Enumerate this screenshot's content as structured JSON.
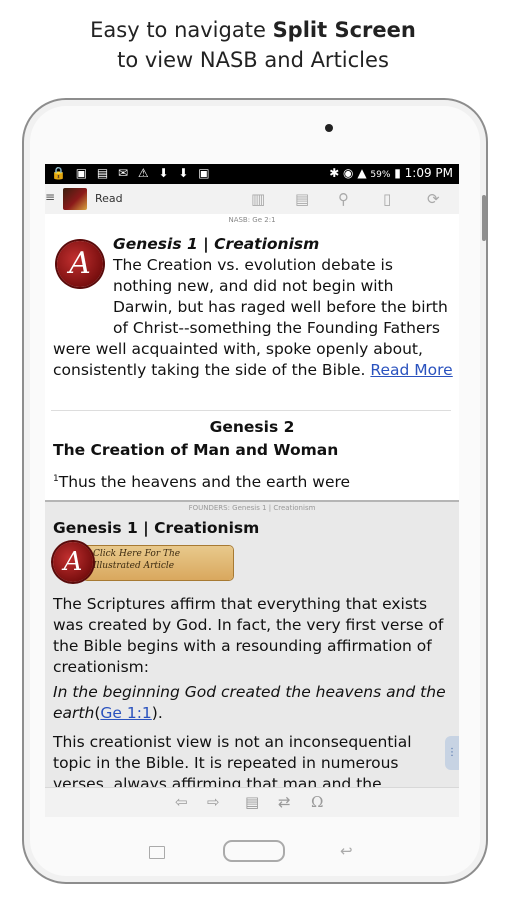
{
  "caption": {
    "line1_prefix": "Easy to navigate ",
    "line1_bold": "Split Screen",
    "line2": "to view NASB and Articles"
  },
  "status_bar": {
    "notification_icons": "🔒 ▣ ▤ ✉ ⚠ ⬇ ⬇ ▣",
    "battery": "59%",
    "time": "1:09 PM"
  },
  "action_bar": {
    "title": "Read",
    "icons": [
      "book-open-icon",
      "book-icon",
      "search-icon",
      "bookmark-icon",
      "sync-icon"
    ]
  },
  "pane_top": {
    "location_label": "NASB: Ge 2:1",
    "article_title": "Genesis 1 | Creationism",
    "article_text": "The Creation vs. evolution debate is nothing new, and did not begin with Darwin, but has raged well before the birth of Christ--something the Founding Fathers were well acquainted with, spoke openly about, consistently taking the side of the Bible.",
    "read_more": "Read More",
    "chapter_heading": "Genesis 2",
    "section_heading": "The Creation of Man and Woman",
    "verse_number": "1",
    "verse_text": "Thus the heavens and the earth were"
  },
  "pane_bottom": {
    "location_label": "FOUNDERS: Genesis 1 | Creationism",
    "title": "Genesis 1 | Creationism",
    "banner_text": "Click Here For The Illustrated Article",
    "para1": "The Scriptures affirm that everything that exists was created by God. In fact, the very first verse of the Bible begins with a resounding affirmation of creationism:",
    "quote": "In the beginning God created the heavens and the earth",
    "quote_ref": "Ge 1:1",
    "quote_end": ").",
    "quote_open": "(",
    "para2": "This creationist view is not an inconsequential topic in the Bible. It is repeated in numerous verses, always affirming that man and the"
  },
  "bottom_bar": {
    "icons": [
      "back-arrow-icon",
      "forward-arrow-icon",
      "book-icon",
      "swap-icon",
      "omega-icon"
    ],
    "omega": "Ω",
    "swap": "⇄",
    "back": "⇦",
    "forward": "⇨"
  },
  "logo_letter": "A"
}
